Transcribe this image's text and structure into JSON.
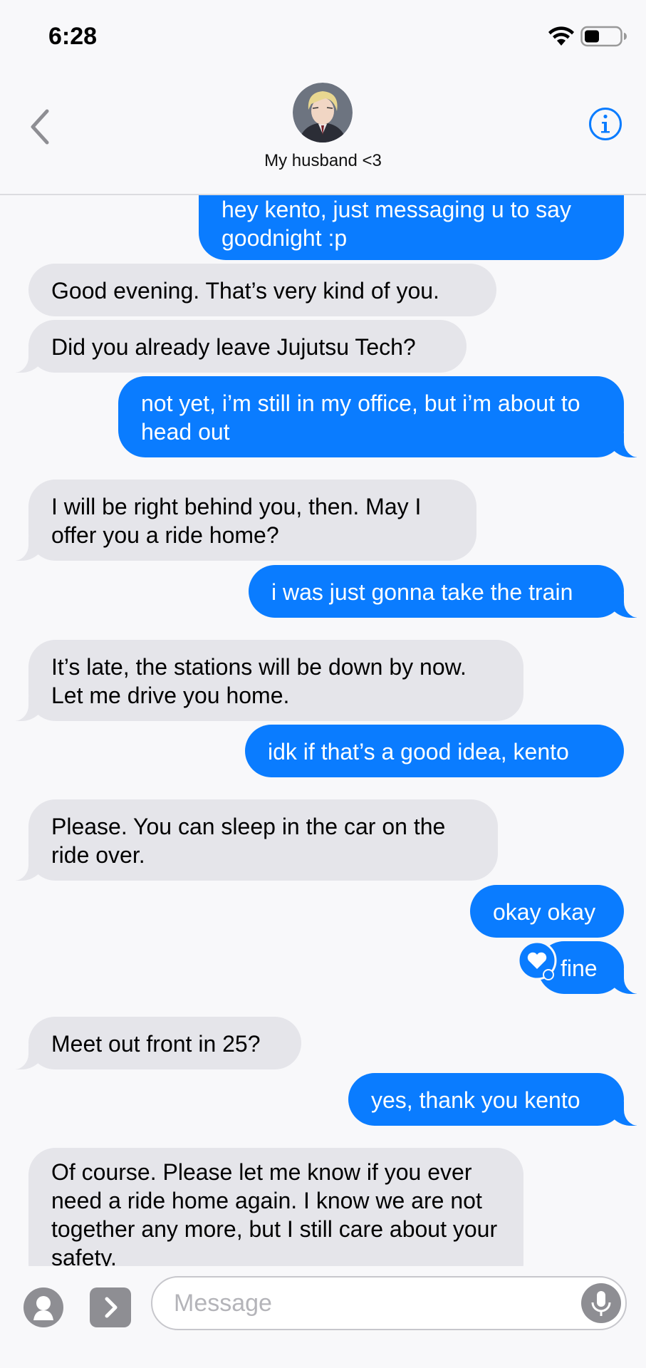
{
  "status_bar": {
    "time": "6:28"
  },
  "header": {
    "contact_name": "My husband <3"
  },
  "messages": [
    {
      "from": "me",
      "text": "hey kento, just messaging u to say goodnight :p"
    },
    {
      "from": "them",
      "text": "Good evening. That’s very kind of you."
    },
    {
      "from": "them",
      "text": "Did you already leave Jujutsu Tech?"
    },
    {
      "from": "me",
      "text": "not yet, i’m still in my office, but i’m about to head out"
    },
    {
      "from": "them",
      "text": "I will be right behind you, then. May I offer you a ride home?"
    },
    {
      "from": "me",
      "text": "i was just gonna take the train"
    },
    {
      "from": "them",
      "text": "It’s late, the stations will be down by now. Let me drive you home."
    },
    {
      "from": "me",
      "text": "idk if that’s a good idea, kento"
    },
    {
      "from": "them",
      "text": "Please. You can sleep in the car on the ride over."
    },
    {
      "from": "me",
      "text": "okay okay"
    },
    {
      "from": "me",
      "text": "fine"
    },
    {
      "from": "them",
      "text": "Meet out front in 25?"
    },
    {
      "from": "me",
      "text": "yes, thank you kento"
    },
    {
      "from": "them",
      "text": "Of course. Please let me know if you ever need a ride home again. I know we are not together any more, but I still care about your safety.",
      "tapback": "heart-icon"
    }
  ],
  "composer": {
    "placeholder": "Message"
  },
  "colors": {
    "outgoing": "#0a7cff",
    "incoming": "#e5e5ea",
    "accent": "#0a7cff"
  }
}
